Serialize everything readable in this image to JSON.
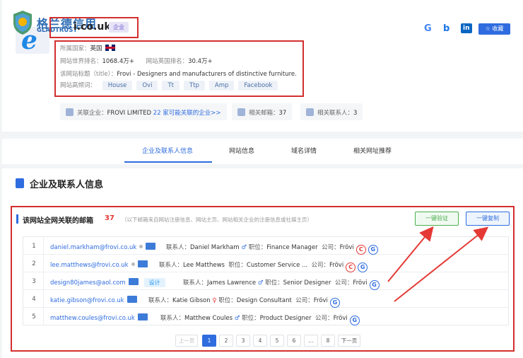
{
  "watermark": {
    "title": "格兰德信用",
    "subtitle": "GLADTRUST"
  },
  "site": {
    "domain": "i.co.uk",
    "tag": "企业",
    "country_label": "所属国家：",
    "country": "英国",
    "world_rank_label": "网站世界排名：",
    "world_rank": "1068.4万+",
    "uk_rank_label": "网站英国排名：",
    "uk_rank": "30.4万+",
    "title_label": "该网站标题（title）：",
    "title": "Frovi - Designers and manufacturers of distinctive furniture.",
    "keywords_label": "网站高频词：",
    "keywords": [
      "House",
      "Ovi",
      "Tt",
      "Ttp",
      "Amp",
      "Facebook"
    ]
  },
  "social": {
    "google": "G",
    "bing": "b",
    "linkedin": "in",
    "favorite_label": "☆ 收藏"
  },
  "chips": {
    "company_label": "关联企业：",
    "company": "FROVI LIMITED",
    "company_link": "22 家可能关联的企业>>",
    "email_label": "相关邮箱：",
    "email_count": "37",
    "contact_label": "相关联系人：",
    "contact_count": "3"
  },
  "tabs": [
    "企业及联系人信息",
    "网站信息",
    "域名详情",
    "相关网址推荐"
  ],
  "section_title": "企业及联系人信息",
  "emails_section": {
    "title": "该网站全网关联的邮箱",
    "count": "37",
    "note": "（以下邮箱来自网站注册信息、网站主页、网站相关企业的注册信息或社媒主页）",
    "verify_label": "一键验证",
    "copy_label": "一键复制"
  },
  "rows": [
    {
      "num": "1",
      "email": "daniel.markham@frovi.co.uk",
      "contact_label": "联系人：",
      "contact": "Daniel Markham",
      "gender": "♂",
      "position_label": "职位：",
      "position": "Finance Manager",
      "company_label": "公司：",
      "company": "Frövi",
      "c": "C",
      "g": "G"
    },
    {
      "num": "2",
      "email": "lee.matthews@frovi.co.uk",
      "contact_label": "联系人：",
      "contact": "Lee Matthews",
      "gender": "",
      "position_label": "职位：",
      "position": "Customer Service ...",
      "company_label": "公司：",
      "company": "Frövi",
      "c": "C",
      "g": "G"
    },
    {
      "num": "3",
      "email": "design80james@aol.com",
      "badge": "设计",
      "contact_label": "联系人：",
      "contact": "James Lawrence",
      "gender": "♂",
      "position_label": "职位：",
      "position": "Senior Designer",
      "company_label": "公司：",
      "company": "Frövi",
      "g": "G"
    },
    {
      "num": "4",
      "email": "katie.gibson@frovi.co.uk",
      "contact_label": "联系人：",
      "contact": "Katie Gibson",
      "gender": "♀",
      "position_label": "职位：",
      "position": "Design Consultant",
      "company_label": "公司：",
      "company": "Frövi",
      "g": "G"
    },
    {
      "num": "5",
      "email": "matthew.coules@frovi.co.uk",
      "contact_label": "联系人：",
      "contact": "Matthew Coules",
      "gender": "♂",
      "position_label": "职位：",
      "position": "Product Designer",
      "company_label": "公司：",
      "company": "Frövi",
      "g": "G"
    }
  ],
  "pagination": {
    "prev": "上一页",
    "pages": [
      "1",
      "2",
      "3",
      "4",
      "5",
      "6",
      "...",
      "8"
    ],
    "next": "下一页",
    "current": "1"
  },
  "colors": {
    "accent": "#2f6cdf",
    "highlight_red": "#d32f2f",
    "verify_green": "#4caf50"
  }
}
